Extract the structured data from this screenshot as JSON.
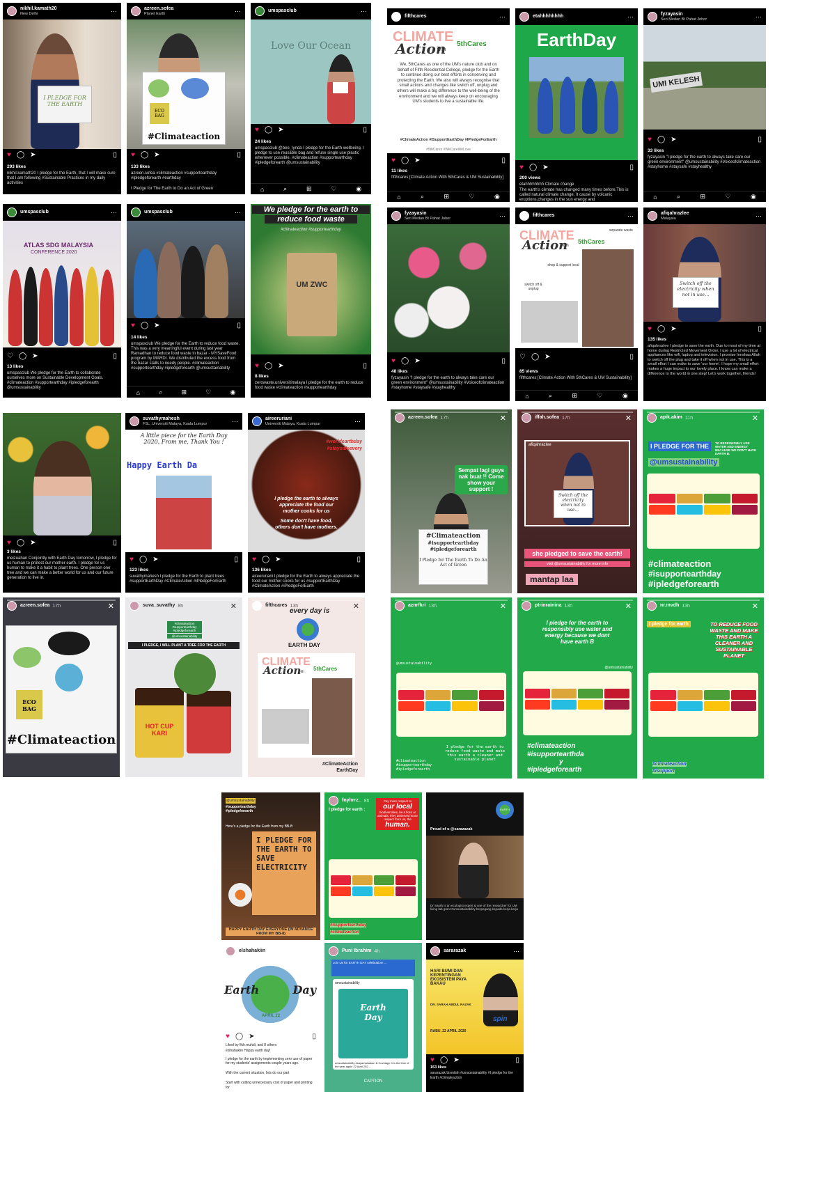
{
  "posts": {
    "p1": {
      "user": "nikhil.kamath20",
      "loc": "New Delhi",
      "sign": "I PLEDGE FOR THE EARTH",
      "likes": "293 likes",
      "caption": "nikhil.kamath20 I pledge for the Earth, that I will make sure that I am following #Sustainable Practices in my daily activities"
    },
    "p2": {
      "user": "azreen.sofea",
      "loc": "Planet Earth",
      "poster": "#Climateaction",
      "eco": "ECO BAG",
      "likes": "133 likes",
      "caption": "azreen.sofea #climateaction #supportearthday #ipledgeforearth #earthday",
      "caption2": "I Pledge for The Earth to Do an Act of Green"
    },
    "p3": {
      "user": "umspasclub",
      "banner": "Love Our Ocean",
      "likes": "24 likes",
      "caption": "umspasclub @bee_lynda I pledge for the Earth wellbeing. I pledge to use reusable bag and refuse single use plastic whenever possible. #climateaction #supportearthday #ipledgeforearth @umsustainability"
    },
    "p4": {
      "user": "fifthcares",
      "title": "CLIMATE",
      "title2": "Action",
      "with": "with",
      "brand": "5thCares",
      "body": "We, 5thCares as one of the UM's nature club and on behalf of Fifth Residential College, pledge for the Earth to continue doing our best efforts in conserving and protecting the Earth. We also will always recognise that small actions and changes like switch off, unplug and others will make a big difference to the well-being of the environment and we will always keep on encouraging UM's students to live a sustainable life.",
      "tags": "#ClimateAction #ISupportEarthDay #IPledgeForEarth",
      "tags2": "#5thCares #WeCareWeLove",
      "likes": "11 likes",
      "caption": "fifthcares [Climate Action With 5thCares & UM Sustainability]"
    },
    "p5": {
      "user": "etahhhhhhhh",
      "banner": "EarthDay",
      "likes": "200 views",
      "caption": "etahhhhhhhh Climate change",
      "caption2": "The earth's climate has changed many times before.This is called natural climate change. It cause by volcanic eruptions,changes in the sun energy and"
    },
    "p6": {
      "user": "fyzayasin",
      "loc": "Seri Medan Bt Pahat Johor",
      "sign": "UMI KELESH",
      "likes": "33 likes",
      "caption": "fyzayasin \"I pledge for the earth to always take care our green environment\" @umsustainability #Voiceofclimateaction #stayhome #staysafe #stayhealthy"
    },
    "p7": {
      "user": "umspasclub",
      "banner": "ATLAS SDG MALAYSIA",
      "banner2": "CONFERENCE 2020",
      "likes": "13 likes",
      "caption": "umspasclub We pledge for the Earth to reduce food waste. #climateaction #supportearthday #ipledgeforearth @umsustainability"
    },
    "p7b": {
      "caption": "umspasclub We pledge for the Earth to collaborate ourselves more on Sustainable Development Goals. #climateaction #supportearthday #ipledgeforearth @umsustainability"
    },
    "p8": {
      "user": "umspasclub",
      "likes": "14 likes",
      "caption": "umspasclub We pledge for the Earth to reduce food waste. This was a very meaningful event during last year Ramadhan to reduce food waste in bazar - MYSaveFood program by MARDI. We distributed the excess food from the bazar stalls to needy people. #climateaction #supportearthday #ipledgeforearth @umsustainability"
    },
    "p9": {
      "headline": "We pledge for the earth to",
      "headline2": "reduce food waste",
      "tags": "#climateaction #supportearthday",
      "bag": "UM ZWC",
      "likes": "8 likes",
      "caption": "zerowaste.universitimalaya I pledge for the earth to reduce food waste #climateaction #supportearthday"
    },
    "p10": {
      "user": "fyzayasin",
      "loc": "Seri Medan Bt Pahat Johor",
      "likes": "48 likes",
      "caption": "fyzayasin \"I pledge for the earth to always take care our green environment\" @umsustainability #Voiceofclimateaction #stayhome #staysafe #stayhealthy"
    },
    "p11": {
      "user": "fifthcares",
      "title": "CLIMATE",
      "title2": "Action",
      "with": "with",
      "brand": "5thCares",
      "l1": "separate waste",
      "l2": "shop & support local",
      "l3": "switch off & unplug",
      "likes": "85 views",
      "caption": "fifthcares [Climate Action With 5thCares & UM Sustainability]"
    },
    "p12": {
      "user": "afiqahrazlee",
      "loc": "Malaysia",
      "sign": "Switch off the electricity when not in use...",
      "likes": "135 likes",
      "caption": "afiqahrazlee I pledge to save the earth. Due to most of my time at home during Restricted Movement Order, I use a lot of electrical appliances like wifi, laptop and television. I promise Innshaa Allah to switch off the plug and take it off when not in use. This is a small effort I can make to save 'our home'. I hope my small effort makes a huge impact to our lovely place. I know can make a difference to the world in one step! Let's work together, friends!"
    },
    "p13": {
      "likes": "3 likes",
      "caption": "meizuahan Conjointly with Earth Day tomorrow, I pledge for us human to protect our mother earth. I pledge for us human to make it a habit to plant trees. One person one tree and we can make a better world for us and our future generation to live in."
    },
    "p14": {
      "user": "suvathymahesh",
      "loc": "FSL, Universiti Malaya, Kuala Lumpur",
      "msg": "A little piece for the Earth Day 2020, From me, Thank You !",
      "banner": "Happy Earth Da",
      "likes": "123 likes",
      "caption": "suvathymahesh I pledge for the Earth to plant trees #supportEarthDay #ClimateAction #iPledgeForEarth"
    },
    "p15": {
      "user": "aireeruriani",
      "loc": "Universiti Malaya, Kuala Lumpur",
      "tag": "#worldearthday",
      "tag2": "#staysafeevery",
      "t1": "I pledge the earth to always",
      "t2": "appreciate the food our",
      "t3": "mother cooks for us",
      "t4": "Some don't have food,",
      "t5": "others don't have mothers.",
      "likes": "136 likes",
      "caption": "aireeruriani I pledge for the Earth to always appreciate the food our mother cooks for us #supportEarthDay #ClimateAction #iPledgeForEarth"
    }
  },
  "stories": {
    "s1": {
      "user": "azreen.sofea",
      "time": "17h",
      "bubble": "Sempat lagi guys nak buat !! Come show your support !",
      "sign": "#Climateaction",
      "s2": "#isupportearthday",
      "s3": "#ipledgeforearth",
      "s4": "I Pledge for The Earth To Do An Act of Green"
    },
    "s2": {
      "user": "iffah.sofea",
      "time": "17h",
      "quoted": "afiqahrazlee",
      "sign": "Switch off the electricity when not in use...",
      "pink": "she pledged to save the earth!",
      "visit": "visit @umsustainability for more info",
      "mantap": "mantap laa"
    },
    "s3": {
      "user": "apik.akim",
      "time": "11h",
      "pledge": "I PLEDGE FOR THE",
      "small": "TO RESPONSIBLY USE WATER AND ENERGY BECAUSE WE DON'T HAVE EARTH B.",
      "handle": "@umsustainability",
      "t1": "#climateaction",
      "t2": "#isupportearthday",
      "t3": "#ipledgeforearth"
    },
    "s4": {
      "user": "azreen.sofea",
      "time": "17h",
      "poster": "#Climateaction",
      "eco": "ECO BAG"
    },
    "s5": {
      "user": "suva_suvathy",
      "time": "8h",
      "tags": "#climateaction #supportearthday #ipledgeforearth",
      "handle": "@umsustainability",
      "banner": "I PLEDGE, I WILL PLANT A TREE FOR THE EARTH",
      "cup": "HOT CUP",
      "kari": "KARI"
    },
    "s6": {
      "user": "fifthcares",
      "time": "13h",
      "cloud": "every day is",
      "earth": "EARTH DAY",
      "title": "CLIMATE",
      "title2": "Action",
      "with": "with",
      "brand": "5thCares",
      "tag": "#ClimateAction",
      "tag2": "EarthDay"
    },
    "s7": {
      "user": "aznrfkri",
      "time": "13h",
      "handle": "@umsustainability",
      "pledge": "I pledge for the earth to reduce food waste and make this earth a cleaner and sustainable planet",
      "tags": "#climateaction #isupportearthday #ipledgeforearth"
    },
    "s8": {
      "user": "ptrinrainina",
      "time": "13h",
      "pledge": "I pledge for the earth to responsibly use water and energy because we dont have earth B",
      "handle": "@umsustainability",
      "t1": "#climateaction",
      "t2": "#isupportearthda",
      "t3": "y",
      "t4": "#ipledgeforearth"
    },
    "s9": {
      "user": "nr.mvdh",
      "time": "13h",
      "pledge": "I pledge for earth",
      "red": "TO REDUCE FOOD WASTE AND MAKE THIS EARTH A CLEANER AND SUSTAINABLE PLANET",
      "t1": "#climateaction",
      "t2": "#isupport"
    },
    "s10": {
      "handle": "@umsustainability",
      "tags": "#isupportearthday #ipledgeforearth",
      "intro": "Here's a pledge for the Earth from my BB-8:",
      "sign": "I PLEDGE FOR THE EARTH TO SAVE ELECTRICITY",
      "footer": "HAPPY EARTH DAY EVERYONE (IN ADVANCE FROM MY BB-8)"
    },
    "s11": {
      "user": "fnyhrrz_",
      "time": "8h",
      "top": "I pledge for earth :",
      "red1": "Pay more respect to",
      "red2": "our local",
      "red3": "biodiversities, be it flora or animals, they deserved more respect from us, the",
      "red4": "human.",
      "tag1": "#isupportearthday",
      "tag2": "#climateaction"
    },
    "s12": {
      "proud": "Proud of u @sarazazak",
      "news": "Dr Sarah is an ecologist expert & one of the researcher for UM living lab grant #umsustainability berpegang kepada kerja-kerja",
      "earth": "EARTH"
    },
    "s13": {
      "user": "elshahakiin",
      "title": "Earth",
      "title2": "Day",
      "date": "APRIL 22",
      "liked": "Liked by fikh.muhdi, and 8 others",
      "caption": "elshahakiin Happy earth day!",
      "c2": "I pledge for the earth by implementing zero use of paper for my students' assignments couple years ago.",
      "c3": "With the current situation, lets do our part",
      "c4": "Start with cutting unnecessary cost of paper and printing for"
    },
    "s14": {
      "user": "Puni Ibrahim",
      "time": "4h",
      "msg": "Join Us for EARTH DAY celebration! ...",
      "handle": "umsustainability",
      "earth": "Earth",
      "day": "Day",
      "cap": "umsustainability #sayamaluakan & Covidapp It is the time of the year again 22 April 202...",
      "caption": "CAPTION"
    },
    "s15": {
      "user": "sararazak",
      "title": "HARI BUMI DAN KEPENTINGAN EKOSISTEM PAYA BAKAU",
      "speaker": "DR. SARAH ABDUL RAZAK",
      "date": "RABU, 22 APRIL 2020",
      "fm": "spin",
      "likes": "153 likes",
      "caption": "sararazak bismilah #umsustainability #I pledge for the Earth #climateaction"
    }
  }
}
